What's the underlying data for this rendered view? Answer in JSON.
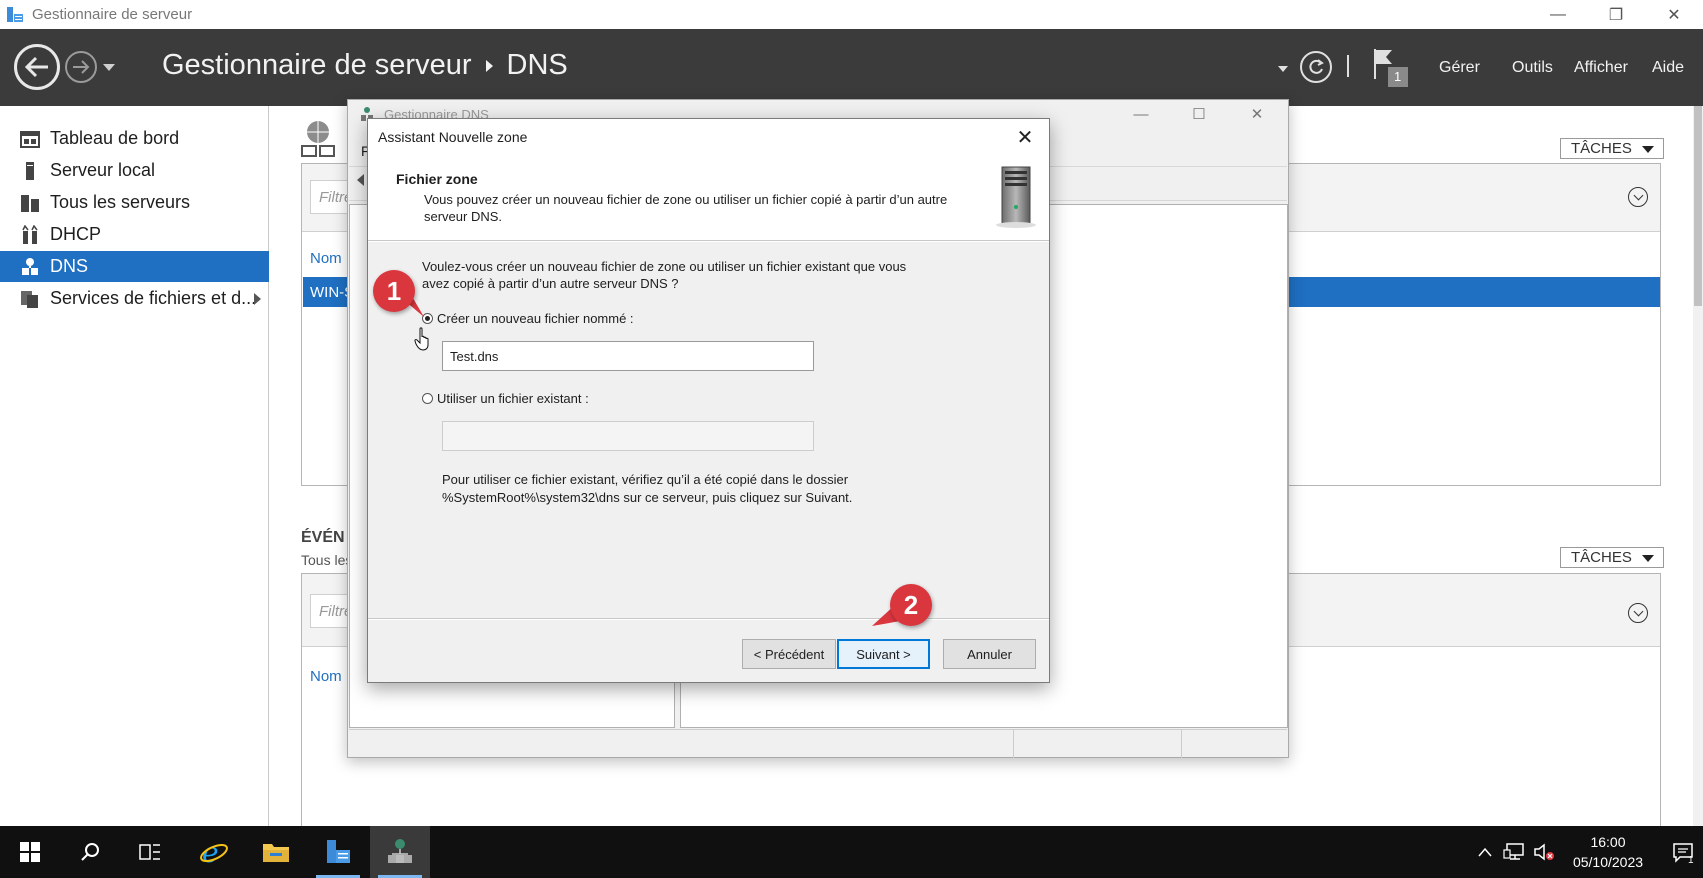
{
  "window": {
    "title": "Gestionnaire de serveur"
  },
  "header": {
    "breadcrumb_root": "Gestionnaire de serveur",
    "breadcrumb_current": "DNS",
    "notification_count": "1",
    "menu": {
      "manage": "Gérer",
      "tools": "Outils",
      "view": "Afficher",
      "help": "Aide"
    }
  },
  "sidebar": {
    "items": [
      {
        "label": "Tableau de bord",
        "icon": "dashboard-icon"
      },
      {
        "label": "Serveur local",
        "icon": "server-icon"
      },
      {
        "label": "Tous les serveurs",
        "icon": "servers-icon"
      },
      {
        "label": "DHCP",
        "icon": "dhcp-icon"
      },
      {
        "label": "DNS",
        "icon": "dns-icon",
        "active": true
      },
      {
        "label": "Services de fichiers et d...",
        "icon": "file-services-icon"
      }
    ]
  },
  "main": {
    "tasks_label": "TÂCHES",
    "filter_placeholder": "Filtre",
    "column_name": "Nom",
    "server_row": "WIN-S",
    "events_title": "ÉVÉN",
    "events_subtitle": "Tous les"
  },
  "dns_manager": {
    "title": "Gestionnaire DNS",
    "letter": "F"
  },
  "wizard": {
    "title": "Assistant Nouvelle zone",
    "header_title": "Fichier zone",
    "header_desc": "Vous pouvez créer un nouveau fichier de zone ou utiliser un fichier copié à partir d’un autre serveur DNS.",
    "question": "Voulez-vous créer un nouveau fichier de zone ou utiliser un fichier existant que vous avez copié à partir d’un autre serveur DNS ?",
    "option_new": "Créer un nouveau fichier nommé :",
    "option_new_value": "Test.dns",
    "option_existing": "Utiliser un fichier existant :",
    "option_existing_value": "",
    "note": "Pour utiliser ce fichier existant, vérifiez qu’il a été copié dans le dossier %SystemRoot%\\system32\\dns sur ce serveur, puis cliquez sur Suivant.",
    "btn_back": "< Précédent",
    "btn_next": "Suivant >",
    "btn_cancel": "Annuler"
  },
  "annotations": {
    "step1": "1",
    "step2": "2"
  },
  "taskbar": {
    "time": "16:00",
    "date": "05/10/2023"
  },
  "colors": {
    "header_bg": "#3b3b3b",
    "accent": "#1f6fc2",
    "badge": "#d9363e",
    "taskbar": "#101010"
  }
}
